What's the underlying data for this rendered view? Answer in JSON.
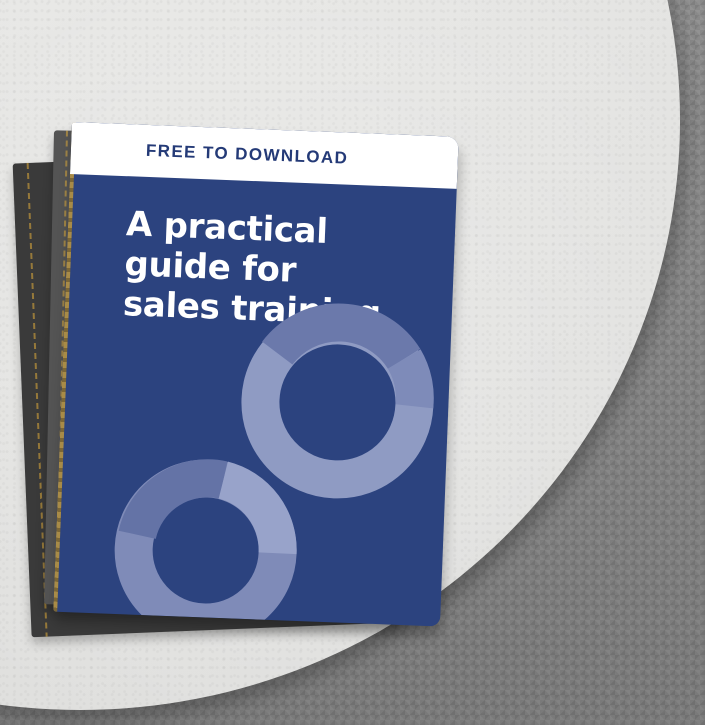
{
  "cover": {
    "badge": "FREE TO DOWNLOAD",
    "title_lines": [
      "A practical",
      "guide for",
      "sales training"
    ]
  }
}
